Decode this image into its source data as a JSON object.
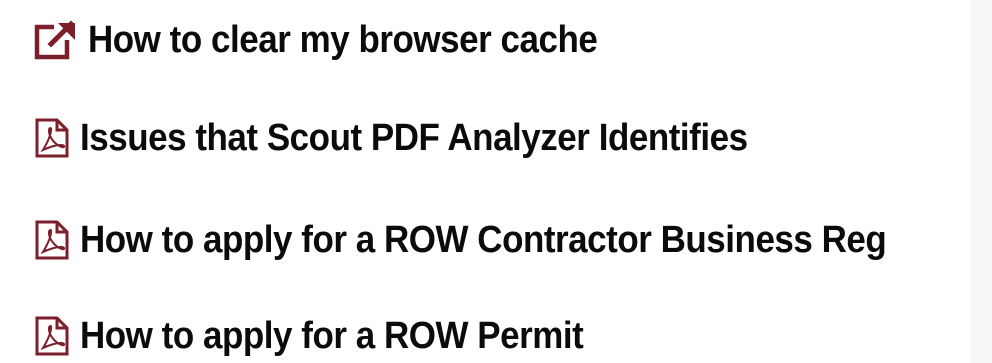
{
  "colors": {
    "icon": "#7b1f2a",
    "text": "#0b0b0b",
    "background": "#ffffff"
  },
  "links": [
    {
      "label": "How to clear my browser cache",
      "icon": "external-link-icon"
    },
    {
      "label": "Issues that Scout PDF Analyzer Identifies",
      "icon": "pdf-file-icon"
    },
    {
      "label": "How to apply for a ROW Contractor Business Reg",
      "icon": "pdf-file-icon"
    },
    {
      "label": "How to apply for a ROW Permit",
      "icon": "pdf-file-icon"
    }
  ]
}
